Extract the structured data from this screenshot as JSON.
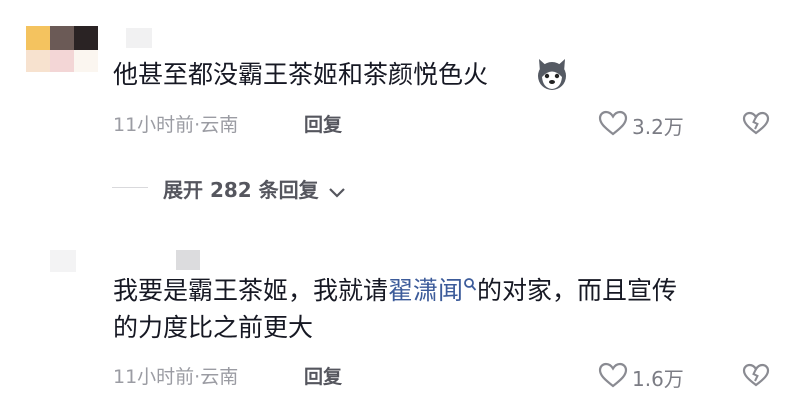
{
  "comments": [
    {
      "text": "他甚至都没霸王茶姬和茶颜悦色火",
      "emoji": "husky-dog-emoji",
      "time_location": "11小时前·云南",
      "reply_label": "回复",
      "like_count": "3.2万"
    },
    {
      "text_before": "我要是霸王茶姬，我就请",
      "link_text": "翟潇闻",
      "text_after_line1": "的对家，而且宣传",
      "text_line2": "的力度比之前更大",
      "time_location": "11小时前·云南",
      "reply_label": "回复",
      "like_count": "1.6万"
    }
  ],
  "expand_replies": {
    "label": "展开 282 条回复"
  },
  "colors": {
    "link": "#3c5b9a",
    "meta": "#9b9ca3",
    "icon": "#8a8b92"
  }
}
